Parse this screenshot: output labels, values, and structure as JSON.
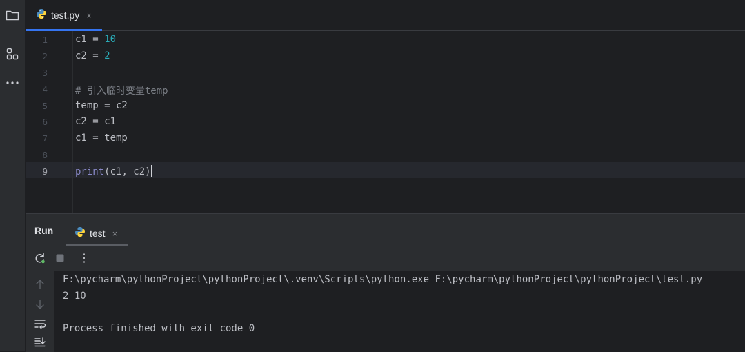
{
  "editor": {
    "tab": {
      "filename": "test.py",
      "close": "×"
    },
    "line_numbers": [
      "1",
      "2",
      "3",
      "4",
      "5",
      "6",
      "7",
      "8",
      "9"
    ],
    "lines": {
      "l1": {
        "var": "c1",
        "op": " = ",
        "num": "10"
      },
      "l2": {
        "var": "c2",
        "op": " = ",
        "num": "2"
      },
      "l4": {
        "comment": "# 引入临时变量temp"
      },
      "l5": {
        "text": "temp = c2"
      },
      "l6": {
        "text": "c2 = c1"
      },
      "l7": {
        "text": "c1 = temp"
      },
      "l9": {
        "func": "print",
        "args": "(c1, c2)"
      }
    }
  },
  "run": {
    "title": "Run",
    "tab": {
      "label": "test",
      "close": "×"
    },
    "toolbar": {
      "more": "⋮"
    },
    "output": [
      "F:\\pycharm\\pythonProject\\pythonProject\\.venv\\Scripts\\python.exe F:\\pycharm\\pythonProject\\pythonProject\\test.py",
      "2 10",
      "",
      "Process finished with exit code 0"
    ]
  },
  "icons": {
    "project": "folder-icon",
    "structure": "structure-icon",
    "more": "more-horizontal-icon",
    "python": "python-icon",
    "rerun": "rerun-icon",
    "stop": "stop-icon",
    "scroll_up": "arrow-up-icon",
    "scroll_down": "arrow-down-icon",
    "soft_wrap": "soft-wrap-icon",
    "scroll_end": "scroll-to-end-icon"
  },
  "colors": {
    "accent": "#3574f0",
    "number": "#2aacb8",
    "builtin": "#8888c6",
    "comment": "#7a7e85",
    "text": "#bcbec4",
    "background": "#1e1f22",
    "panel": "#2b2d30"
  }
}
